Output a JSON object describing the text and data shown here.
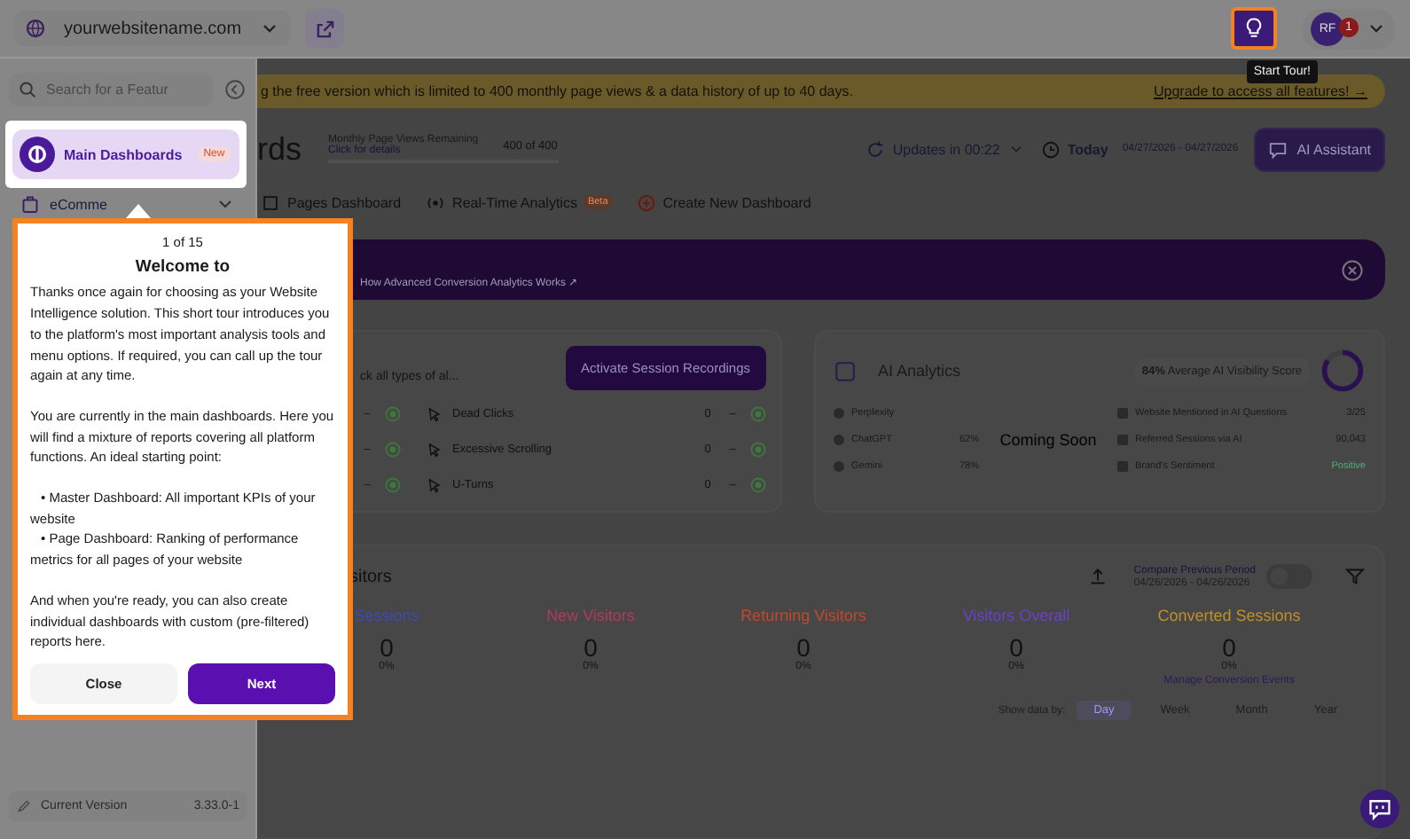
{
  "top_bar": {
    "site": "yourwebsitename.com",
    "avatar": "RF",
    "notifications": "1"
  },
  "start_tour_tooltip": "Start Tour!",
  "sidebar": {
    "search": {
      "placeholder": "Search for a Featur"
    },
    "items": [
      {
        "label": "Main Dashboards",
        "badge": "New",
        "highlighted": true,
        "expandable": false
      },
      {
        "label": "eComme",
        "highlighted": false,
        "expandable": true
      }
    ],
    "version_label": "Current Version",
    "version": "3.33.0-1"
  },
  "notice_banner": {
    "text": "g the free version which is limited to 400 monthly page views & a data history of up to 40 days.",
    "link": "Upgrade to access all features! →"
  },
  "header": {
    "title": "rds",
    "quota_label": "Monthly Page Views Remaining",
    "quota_link": "Click for details",
    "quota_value": "400 of 400",
    "level": 1,
    "updates": "Updates in 00:22",
    "period": "Today",
    "date_range": "04/27/2026 - 04/27/2026",
    "assistant": "AI Assistant"
  },
  "tabs": [
    {
      "label": "Pages Dashboard"
    },
    {
      "label": "Real-Time Analytics",
      "badge": "Beta"
    },
    {
      "label": "Create New Dashboard"
    }
  ],
  "promo_banner": {
    "link": "How Advanced Conversion Analytics Works ↗"
  },
  "session_card": {
    "text": "ck all types of al...",
    "button": "Activate Session Recordings",
    "rows": [
      {
        "label": "Dead Clicks",
        "value": "0",
        "trend": "–",
        "prev_trend": "–"
      },
      {
        "label": "Excessive Scrolling",
        "value": "0",
        "trend": "–",
        "prev_trend": "–"
      },
      {
        "label": "U-Turns",
        "value": "0",
        "trend": "–",
        "prev_trend": "–"
      }
    ]
  },
  "ai_card": {
    "title": "AI Analytics",
    "score": "84%",
    "score_label": "Average AI Visibility Score",
    "level": 0.84,
    "overlay": "Coming Soon",
    "engines": [
      {
        "name": "Perplexity"
      },
      {
        "name": "ChatGPT",
        "value": "62%"
      },
      {
        "name": "Gemini",
        "value": "78%"
      }
    ],
    "metrics": [
      {
        "name": "Website Mentioned in AI Questions",
        "value": "3/25"
      },
      {
        "name": "Referred Sessions via AI",
        "value": "90,043"
      },
      {
        "name": "Brand's Sentiment",
        "value": "Positive"
      }
    ]
  },
  "visitors_card": {
    "title": "sitors",
    "compare_label": "Compare Previous Period",
    "compare_range": "04/26/2026 - 04/26/2026",
    "compare_on": false,
    "metrics": [
      {
        "label": "Sessions",
        "value": "0",
        "change": "0%",
        "color": "#3c4cb0"
      },
      {
        "label": "New Visitors",
        "value": "0",
        "change": "0%",
        "color": "#b03a5e"
      },
      {
        "label": "Returning Visitors",
        "value": "0",
        "change": "0%",
        "color": "#c04a2a"
      },
      {
        "label": "Visitors Overall",
        "value": "0",
        "change": "0%",
        "color": "#6a40c8"
      },
      {
        "label": "Converted Sessions",
        "value": "0",
        "change": "0%",
        "color": "#c0902a"
      }
    ],
    "manage_link": "Manage Conversion Events",
    "show_by_label": "Show data by:",
    "periods": [
      {
        "label": "Day",
        "selected": true
      },
      {
        "label": "Week",
        "selected": false
      },
      {
        "label": "Month",
        "selected": false
      },
      {
        "label": "Year",
        "selected": false
      }
    ]
  },
  "tour_popup": {
    "step": "1 of 15",
    "title": "Welcome to",
    "paragraphs": [
      "Thanks once again for choosing as your Website Intelligence solution. This short tour introduces you to the platform's most important analysis tools and menu options. If required, you can call up the tour again at any time.",
      "You are currently in the main dashboards. Here you will find a mixture of reports covering all platform functions. An ideal starting point:"
    ],
    "bullets": [
      "• Master Dashboard: All important KPIs of your website",
      "• Page Dashboard: Ranking of performance metrics for all pages of your website"
    ],
    "closing": "And when you're ready, you can also create individual dashboards with custom (pre-filtered) reports here.",
    "close": "Close",
    "next": "Next"
  }
}
